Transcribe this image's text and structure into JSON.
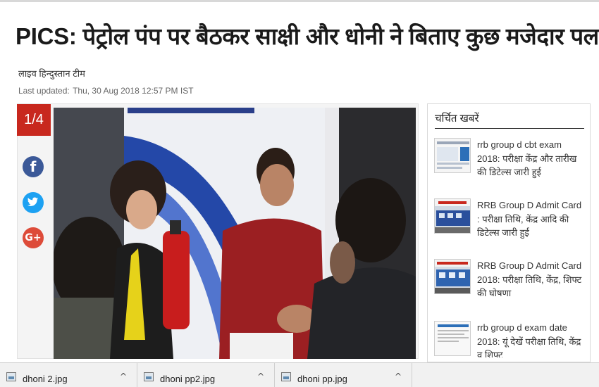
{
  "article": {
    "headline": "PICS: पेट्रोल पंप पर बैठकर साक्षी और धोनी ने बिताए कुछ मजेदार पल",
    "author": "लाइव हिन्दुस्तान टीम",
    "updated_label": "Last updated:",
    "updated_value": "Thu, 30 Aug 2018 12:57 PM IST"
  },
  "gallery": {
    "counter": "1/4",
    "social": [
      {
        "name": "facebook-icon",
        "glyph": "f"
      },
      {
        "name": "twitter-icon",
        "glyph": "🐦"
      },
      {
        "name": "google-plus-icon",
        "glyph": "G+"
      }
    ]
  },
  "sidebar": {
    "title": "चर्चित खबरें",
    "items": [
      {
        "text": "rrb group d cbt exam 2018: परीक्षा केंद्र और तारीख की डिटेल्स जारी हुई"
      },
      {
        "text": "RRB Group D Admit Card : परीक्षा तिथि, केंद्र आदि की डिटेल्स जारी हुई"
      },
      {
        "text": "RRB Group D Admit Card 2018: परीक्षा तिथि, केंद्र, शिफ्ट की घोषणा"
      },
      {
        "text": "rrb group d exam date 2018: यूं देखें परीक्षा तिथि, केंद्र व शिफ्ट"
      }
    ]
  },
  "downloads": [
    {
      "name": "dhoni 2.jpg"
    },
    {
      "name": "dhoni pp2.jpg"
    },
    {
      "name": "dhoni pp.jpg"
    }
  ],
  "colors": {
    "accent": "#c8281e",
    "facebook": "#3b5998",
    "twitter": "#1da1f2",
    "gplus": "#dd4b39"
  }
}
